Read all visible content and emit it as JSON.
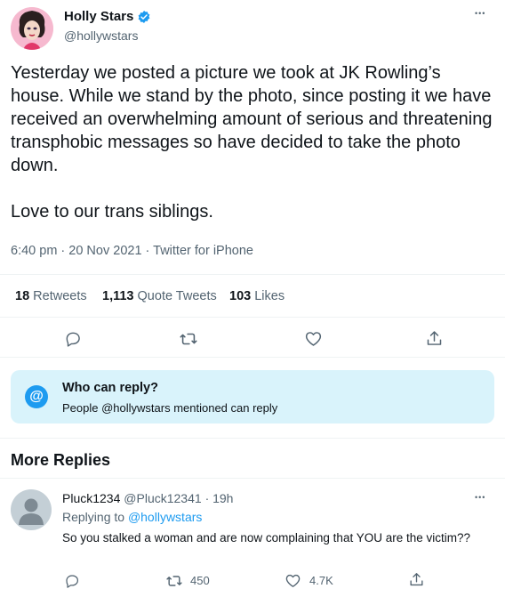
{
  "tweet": {
    "author_name": "Holly Stars",
    "author_handle": "@hollywstars",
    "more_label": "•••",
    "text": "Yesterday we posted a picture we took at JK Rowling’s house. While we stand by the photo, since posting it we have received an overwhelming amount of serious and threatening transphobic messages so have decided to take the photo down.\n\nLove to our trans siblings.",
    "time": "6:40 pm · 20 Nov 2021 · ",
    "source": "Twitter for iPhone",
    "retweets_count": "18",
    "retweets_label": "Retweets",
    "quotes_count": "1,113",
    "quotes_label": "Quote Tweets",
    "likes_count": "103",
    "likes_label": "Likes"
  },
  "who_can_reply": {
    "title": "Who can reply?",
    "subtitle": "People @hollywstars mentioned can reply",
    "icon_label": "@"
  },
  "more_replies": {
    "title": "More Replies"
  },
  "reply": {
    "author_name": "Pluck1234",
    "author_handle": "@Pluck12341",
    "time": "· 19h",
    "replying_to_label": "Replying to ",
    "replying_to_handle": "@hollywstars",
    "text": "So you stalked a woman and are now complaining that YOU are the victim??",
    "retweets": "450",
    "likes": "4.7K",
    "more_label": "•••"
  },
  "colors": {
    "accent": "#1d9bf0",
    "secondary_text": "#536471",
    "verified": "#1d9bf0",
    "reply_box_bg": "#d9f3fb"
  },
  "icons": [
    "verified-badge-icon",
    "reply-icon",
    "retweet-icon",
    "like-icon",
    "share-icon",
    "at-icon",
    "default-avatar-icon"
  ]
}
